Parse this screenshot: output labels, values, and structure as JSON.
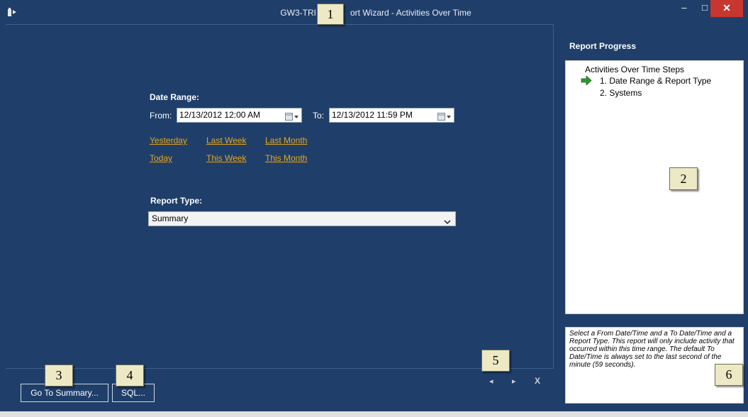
{
  "window": {
    "title": "GW3-TRI... Report Wizard - Activities Over Time",
    "title_left": "GW3-TRI",
    "title_right": "ort Wizard - Activities Over Time",
    "minimize": "–",
    "maximize": "□",
    "close": "✕"
  },
  "date_range": {
    "heading": "Date Range:",
    "from_label": "From:",
    "from_value": "12/13/2012 12:00 AM",
    "to_label": "To:",
    "to_value": "12/13/2012 11:59 PM"
  },
  "quick_links": {
    "yesterday": "Yesterday",
    "last_week": "Last Week",
    "last_month": "Last Month",
    "today": "Today",
    "this_week": "This Week",
    "this_month": "This Month"
  },
  "report_type": {
    "heading": "Report Type:",
    "selected": "Summary"
  },
  "progress": {
    "heading": "Report Progress",
    "root": "Activities Over Time Steps",
    "steps": [
      "1. Date Range & Report Type",
      "2. Systems"
    ]
  },
  "help_text": "Select a From Date/Time and a To Date/Time and a Report Type.  This report will only include activity that occurred within this time range.  The default To Date/Time is always set to the last second of the minute (59 seconds).",
  "buttons": {
    "go_to_summary": "Go To Summary...",
    "sql": "SQL...",
    "prev": "◂",
    "next": "▸",
    "cancel": "X"
  },
  "callouts": [
    "1",
    "2",
    "3",
    "4",
    "5",
    "6"
  ],
  "colors": {
    "background": "#1f3f6a",
    "link": "#e7a51a",
    "close": "#c7372f",
    "callout": "#ece9c4"
  }
}
